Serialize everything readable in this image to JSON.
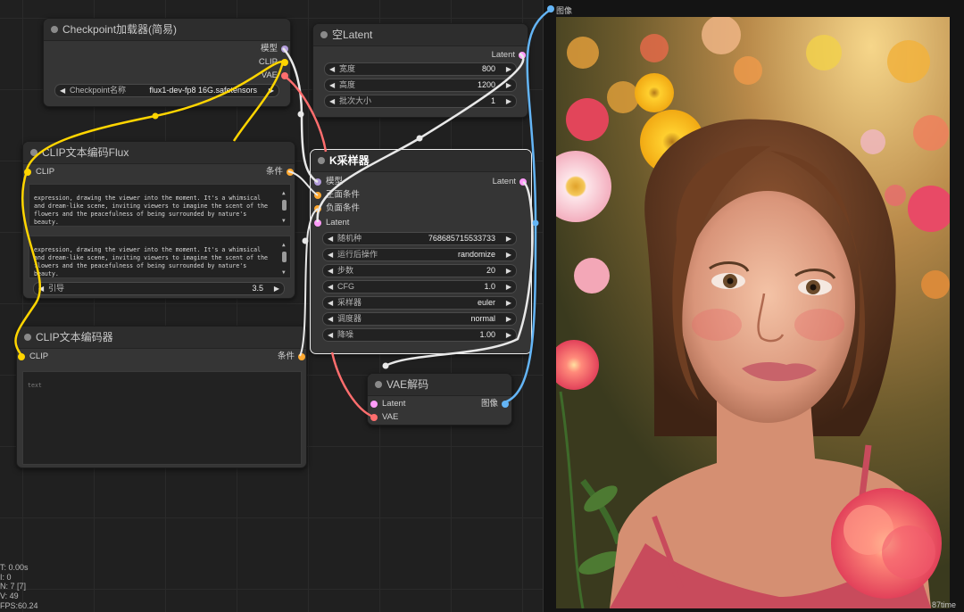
{
  "nodes": {
    "checkpoint": {
      "title": "Checkpoint加载器(简易)",
      "outputs": [
        "模型",
        "CLIP",
        "VAE"
      ],
      "widget": {
        "label": "Checkpoint名称",
        "value": "flux1-dev-fp8 16G.safetensors"
      }
    },
    "empty_latent": {
      "title": "空Latent",
      "output": "Latent",
      "widgets": [
        {
          "label": "宽度",
          "value": "800"
        },
        {
          "label": "高度",
          "value": "1200"
        },
        {
          "label": "批次大小",
          "value": "1"
        }
      ]
    },
    "clip_flux": {
      "title": "CLIP文本编码Flux",
      "input": "CLIP",
      "output": "条件",
      "text1": "expression, drawing the viewer into the moment. It's a whimsical and dream-like scene, inviting viewers to imagine the scent of the flowers and the peacefulness of being surrounded by nature's beauty.",
      "text2": "expression, drawing the viewer into the moment. It's a whimsical and dream-like scene, inviting viewers to imagine the scent of the flowers and the peacefulness of being surrounded by nature's beauty.",
      "guidance": {
        "label": "引导",
        "value": "3.5"
      }
    },
    "clip_encode": {
      "title": "CLIP文本编码器",
      "input": "CLIP",
      "output": "条件",
      "placeholder": "text"
    },
    "ksampler": {
      "title": "K采样器",
      "inputs": [
        "模型",
        "正面条件",
        "负面条件",
        "Latent"
      ],
      "output": "Latent",
      "widgets": [
        {
          "label": "随机种",
          "value": "768685715533733"
        },
        {
          "label": "运行后操作",
          "value": "randomize"
        },
        {
          "label": "步数",
          "value": "20"
        },
        {
          "label": "CFG",
          "value": "1.0"
        },
        {
          "label": "采样器",
          "value": "euler"
        },
        {
          "label": "调度器",
          "value": "normal"
        },
        {
          "label": "降噪",
          "value": "1.00"
        }
      ]
    },
    "vae_decode": {
      "title": "VAE解码",
      "inputs": [
        "Latent",
        "VAE"
      ],
      "output": "图像"
    },
    "preview": {
      "input_label": "图像"
    }
  },
  "stats": {
    "line1": "T: 0.00s",
    "line2": "I: 0",
    "line3": "N: 7 [7]",
    "line4": "V: 49",
    "line5": "FPS:60.24"
  },
  "corner_label": "87time",
  "colors": {
    "model": "#b39ddb",
    "clip": "#ffd500",
    "vae": "#ff6e6e",
    "conditioning": "#ffa931",
    "latent": "#ff9cf9",
    "image": "#64b5f6",
    "link_default": "#e8e8e8"
  }
}
